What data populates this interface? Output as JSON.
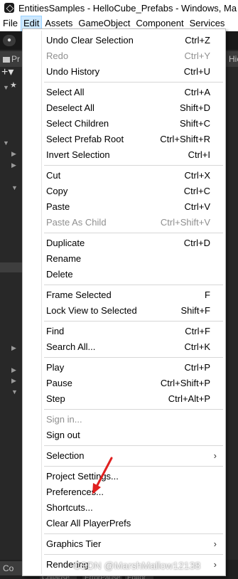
{
  "window": {
    "title": "EntitiesSamples - HelloCube_Prefabs - Windows, Ma"
  },
  "menubar": {
    "items": [
      "File",
      "Edit",
      "Assets",
      "GameObject",
      "Component",
      "Services"
    ]
  },
  "toolbar": {
    "account_label": "●"
  },
  "panels": {
    "project_tab": "Pr",
    "right_tab": "Hie",
    "bottom_tab_left": "Co",
    "bottom_tab_mid": "Collapse",
    "bottom_tab_right": "ErrorPause",
    "bottom_tab_editor": "Editor"
  },
  "edit_menu": {
    "items": [
      {
        "label": "Undo Clear Selection",
        "shortcut": "Ctrl+Z"
      },
      {
        "label": "Redo",
        "shortcut": "Ctrl+Y",
        "disabled": true
      },
      {
        "label": "Undo History",
        "shortcut": "Ctrl+U"
      },
      {
        "label": "Select All",
        "shortcut": "Ctrl+A"
      },
      {
        "label": "Deselect All",
        "shortcut": "Shift+D"
      },
      {
        "label": "Select Children",
        "shortcut": "Shift+C"
      },
      {
        "label": "Select Prefab Root",
        "shortcut": "Ctrl+Shift+R"
      },
      {
        "label": "Invert Selection",
        "shortcut": "Ctrl+I"
      },
      {
        "label": "Cut",
        "shortcut": "Ctrl+X"
      },
      {
        "label": "Copy",
        "shortcut": "Ctrl+C"
      },
      {
        "label": "Paste",
        "shortcut": "Ctrl+V"
      },
      {
        "label": "Paste As Child",
        "shortcut": "Ctrl+Shift+V",
        "disabled": true
      },
      {
        "label": "Duplicate",
        "shortcut": "Ctrl+D"
      },
      {
        "label": "Rename",
        "shortcut": ""
      },
      {
        "label": "Delete",
        "shortcut": ""
      },
      {
        "label": "Frame Selected",
        "shortcut": "F"
      },
      {
        "label": "Lock View to Selected",
        "shortcut": "Shift+F"
      },
      {
        "label": "Find",
        "shortcut": "Ctrl+F"
      },
      {
        "label": "Search All...",
        "shortcut": "Ctrl+K"
      },
      {
        "label": "Play",
        "shortcut": "Ctrl+P"
      },
      {
        "label": "Pause",
        "shortcut": "Ctrl+Shift+P"
      },
      {
        "label": "Step",
        "shortcut": "Ctrl+Alt+P"
      },
      {
        "label": "Sign in...",
        "shortcut": "",
        "disabled": true
      },
      {
        "label": "Sign out",
        "shortcut": ""
      },
      {
        "label": "Selection",
        "shortcut": "",
        "submenu": true
      },
      {
        "label": "Project Settings...",
        "shortcut": ""
      },
      {
        "label": "Preferences...",
        "shortcut": ""
      },
      {
        "label": "Shortcuts...",
        "shortcut": ""
      },
      {
        "label": "Clear All PlayerPrefs",
        "shortcut": ""
      },
      {
        "label": "Graphics Tier",
        "shortcut": "",
        "submenu": true
      },
      {
        "label": "Rendering",
        "shortcut": "",
        "submenu": true
      }
    ],
    "submenu_glyph": "›"
  },
  "watermark": "CSDN @MarshMallow12138",
  "colors": {
    "menu_bg": "#ffffff",
    "menu_active": "#cce8ff",
    "disabled_text": "#8f8f8f",
    "editor_bg": "#282828",
    "annotation": "#e02020"
  }
}
